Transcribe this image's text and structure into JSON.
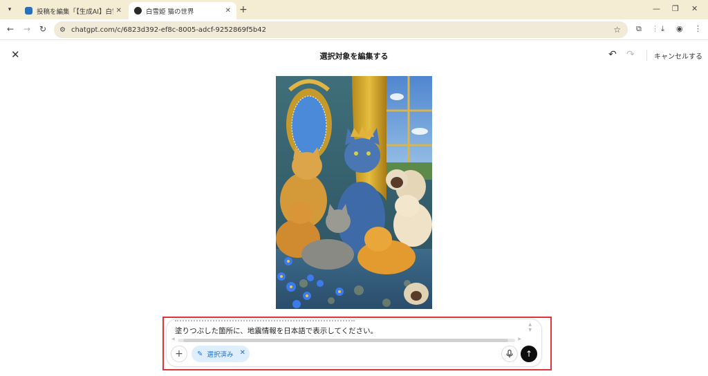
{
  "browser": {
    "tab_search_icon": "chevron-down-icon",
    "tabs": [
      {
        "title": "投稿を編集「【生成AI】白雪姫を描",
        "active": false
      },
      {
        "title": "白雪姫 猫の世界",
        "active": true
      }
    ],
    "new_tab": "+",
    "address": "chatgpt.com/c/6823d392-ef8c-8005-adcf-9252869f5b42"
  },
  "editor": {
    "title": "選択対象を編集する",
    "cancel": "キャンセルする"
  },
  "composer": {
    "prompt": "塗りつぶした箇所に、地震情報を日本語で表示してください。",
    "chip_label": "選択済み"
  },
  "colors": {
    "accent_red": "#e0323b",
    "chip_bg": "#dfeefc",
    "chip_text": "#1a6fd6",
    "send_bg": "#0d0d0d"
  }
}
